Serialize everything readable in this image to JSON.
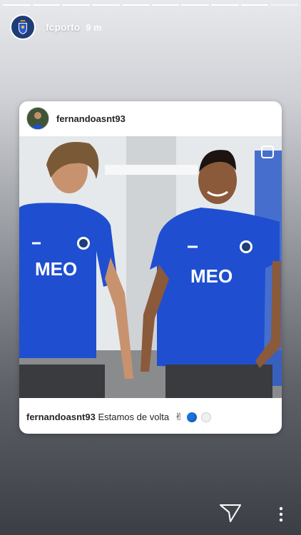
{
  "story": {
    "account": "fcporto",
    "time_ago": "9 m",
    "progress_segments": 10,
    "active_segment": 10
  },
  "post": {
    "username": "fernandoasnt93",
    "caption_user": "fernandoasnt93",
    "caption_text": "Estamos de volta",
    "emoji": [
      "victory-hand",
      "blue-circle",
      "white-circle"
    ],
    "jersey_sponsor": "MEO"
  },
  "controls": {
    "send_icon": "send-icon",
    "more_icon": "more-options-icon"
  },
  "colors": {
    "jersey_blue": "#1f4fd0",
    "card_bg": "#ffffff",
    "text_dark": "#262626"
  }
}
